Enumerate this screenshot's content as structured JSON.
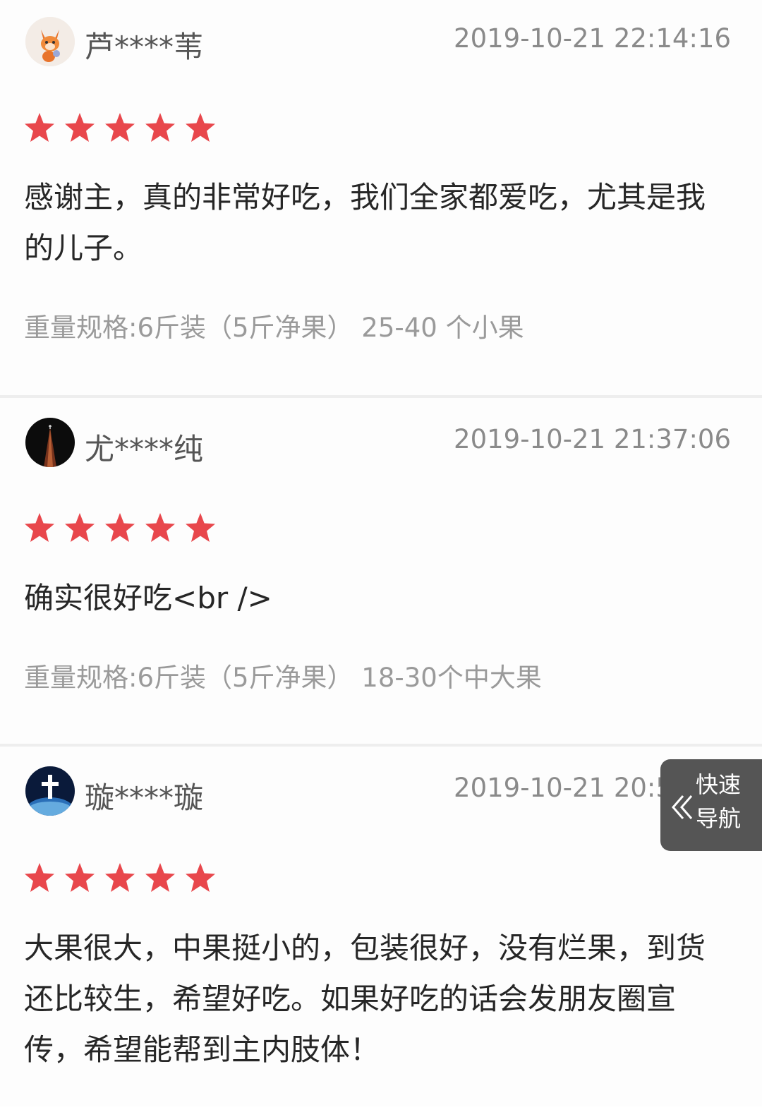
{
  "reviews": [
    {
      "username": "芦****苇",
      "timestamp": "2019-10-21 22:14:16",
      "rating": 5,
      "avatar_icon": "fox-avatar",
      "content": "感谢主，真的非常好吃，我们全家都爱吃，尤其是我的儿子。",
      "spec": "重量规格:6斤装（5斤净果） 25-40 个小果"
    },
    {
      "username": "尤****纯",
      "timestamp": "2019-10-21 21:37:06",
      "rating": 5,
      "avatar_icon": "light-beam-avatar",
      "content": "确实很好吃<br />",
      "spec": "重量规格:6斤装（5斤净果） 18-30个中大果"
    },
    {
      "username": "璇****璇",
      "timestamp": "2019-10-21 20:54:09",
      "rating": 5,
      "avatar_icon": "cross-globe-avatar",
      "content": "大果很大，中果挺小的，包装很好，没有烂果，到货还比较生，希望好吃。如果好吃的话会发朋友圈宣传，希望能帮到主内肢体！"
    }
  ],
  "quick_nav": {
    "line1": "快速",
    "line2": "导航"
  },
  "colors": {
    "star": "#e8474c",
    "nav_bg": "#555555"
  }
}
